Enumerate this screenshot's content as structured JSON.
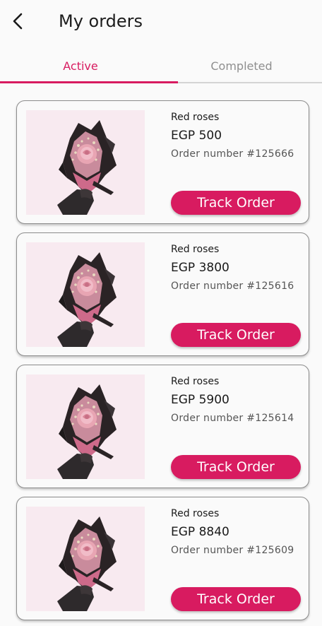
{
  "header": {
    "title": "My orders",
    "back_icon": "chevron-left-icon"
  },
  "tabs": [
    {
      "label": "Active",
      "selected": true
    },
    {
      "label": "Completed",
      "selected": false
    }
  ],
  "colors": {
    "accent": "#d81b60",
    "inactive_tab": "#8f8f8f",
    "card_border": "#8c8c8c",
    "image_bg": "#f7e9ef"
  },
  "orders": [
    {
      "name": "Red roses",
      "price": "EGP 500",
      "order_number": "Order number #125666",
      "button_label": "Track Order",
      "image": "rose-bouquet-image"
    },
    {
      "name": "Red roses",
      "price": "EGP 3800",
      "order_number": "Order number #125616",
      "button_label": "Track Order",
      "image": "rose-bouquet-image"
    },
    {
      "name": "Red roses",
      "price": "EGP 5900",
      "order_number": "Order number #125614",
      "button_label": "Track Order",
      "image": "rose-bouquet-image"
    },
    {
      "name": "Red roses",
      "price": "EGP 8840",
      "order_number": "Order number #125609",
      "button_label": "Track Order",
      "image": "rose-bouquet-image"
    }
  ]
}
